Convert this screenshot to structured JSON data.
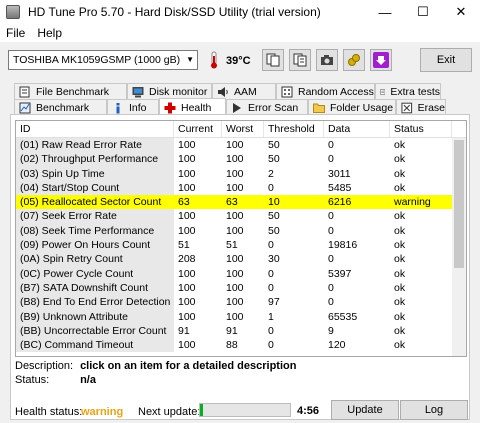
{
  "window": {
    "title": "HD Tune Pro 5.70 - Hard Disk/SSD Utility (trial version)"
  },
  "menu": {
    "file": "File",
    "help": "Help"
  },
  "toolbar": {
    "drive": "TOSHIBA MK1059GSMP (1000 gB)",
    "temperature": "39°C",
    "exit": "Exit"
  },
  "tabs_top": [
    {
      "label": "File Benchmark",
      "icon": "file-benchmark-icon"
    },
    {
      "label": "Disk monitor",
      "icon": "disk-monitor-icon"
    },
    {
      "label": "AAM",
      "icon": "speaker-icon"
    },
    {
      "label": "Random Access",
      "icon": "random-access-icon"
    },
    {
      "label": "Extra tests",
      "icon": "extra-tests-icon"
    }
  ],
  "tabs_bottom": [
    {
      "label": "Benchmark",
      "icon": "benchmark-icon"
    },
    {
      "label": "Info",
      "icon": "info-icon"
    },
    {
      "label": "Health",
      "icon": "health-cross-icon",
      "active": true
    },
    {
      "label": "Error Scan",
      "icon": "error-scan-icon"
    },
    {
      "label": "Folder Usage",
      "icon": "folder-icon"
    },
    {
      "label": "Erase",
      "icon": "erase-icon"
    }
  ],
  "table": {
    "headers": [
      "ID",
      "Current",
      "Worst",
      "Threshold",
      "Data",
      "Status"
    ],
    "rows": [
      [
        "(01) Raw Read Error Rate",
        "100",
        "100",
        "50",
        "0",
        "ok"
      ],
      [
        "(02) Throughput Performance",
        "100",
        "100",
        "50",
        "0",
        "ok"
      ],
      [
        "(03) Spin Up Time",
        "100",
        "100",
        "2",
        "3011",
        "ok"
      ],
      [
        "(04) Start/Stop Count",
        "100",
        "100",
        "0",
        "5485",
        "ok"
      ],
      [
        "(05) Reallocated Sector Count",
        "63",
        "63",
        "10",
        "6216",
        "warning"
      ],
      [
        "(07) Seek Error Rate",
        "100",
        "100",
        "50",
        "0",
        "ok"
      ],
      [
        "(08) Seek Time Performance",
        "100",
        "100",
        "50",
        "0",
        "ok"
      ],
      [
        "(09) Power On Hours Count",
        "51",
        "51",
        "0",
        "19816",
        "ok"
      ],
      [
        "(0A) Spin Retry Count",
        "208",
        "100",
        "30",
        "0",
        "ok"
      ],
      [
        "(0C) Power Cycle Count",
        "100",
        "100",
        "0",
        "5397",
        "ok"
      ],
      [
        "(B7) SATA Downshift Count",
        "100",
        "100",
        "0",
        "0",
        "ok"
      ],
      [
        "(B8) End To End Error Detection",
        "100",
        "100",
        "97",
        "0",
        "ok"
      ],
      [
        "(B9) Unknown Attribute",
        "100",
        "100",
        "1",
        "65535",
        "ok"
      ],
      [
        "(BB) Uncorrectable Error Count",
        "91",
        "91",
        "0",
        "9",
        "ok"
      ],
      [
        "(BC) Command Timeout",
        "100",
        "88",
        "0",
        "120",
        "ok"
      ]
    ],
    "selected_row": 4
  },
  "details": {
    "description_label": "Description:",
    "description_value": "click on an item for a detailed description",
    "status_label": "Status:",
    "status_value": "n/a"
  },
  "footer": {
    "health_label": "Health status:",
    "health_value": "warning",
    "health_color": "#e8a317",
    "next_update_label": "Next update:",
    "progress": 0.03,
    "time": "4:56",
    "update_button": "Update",
    "log_button": "Log"
  }
}
